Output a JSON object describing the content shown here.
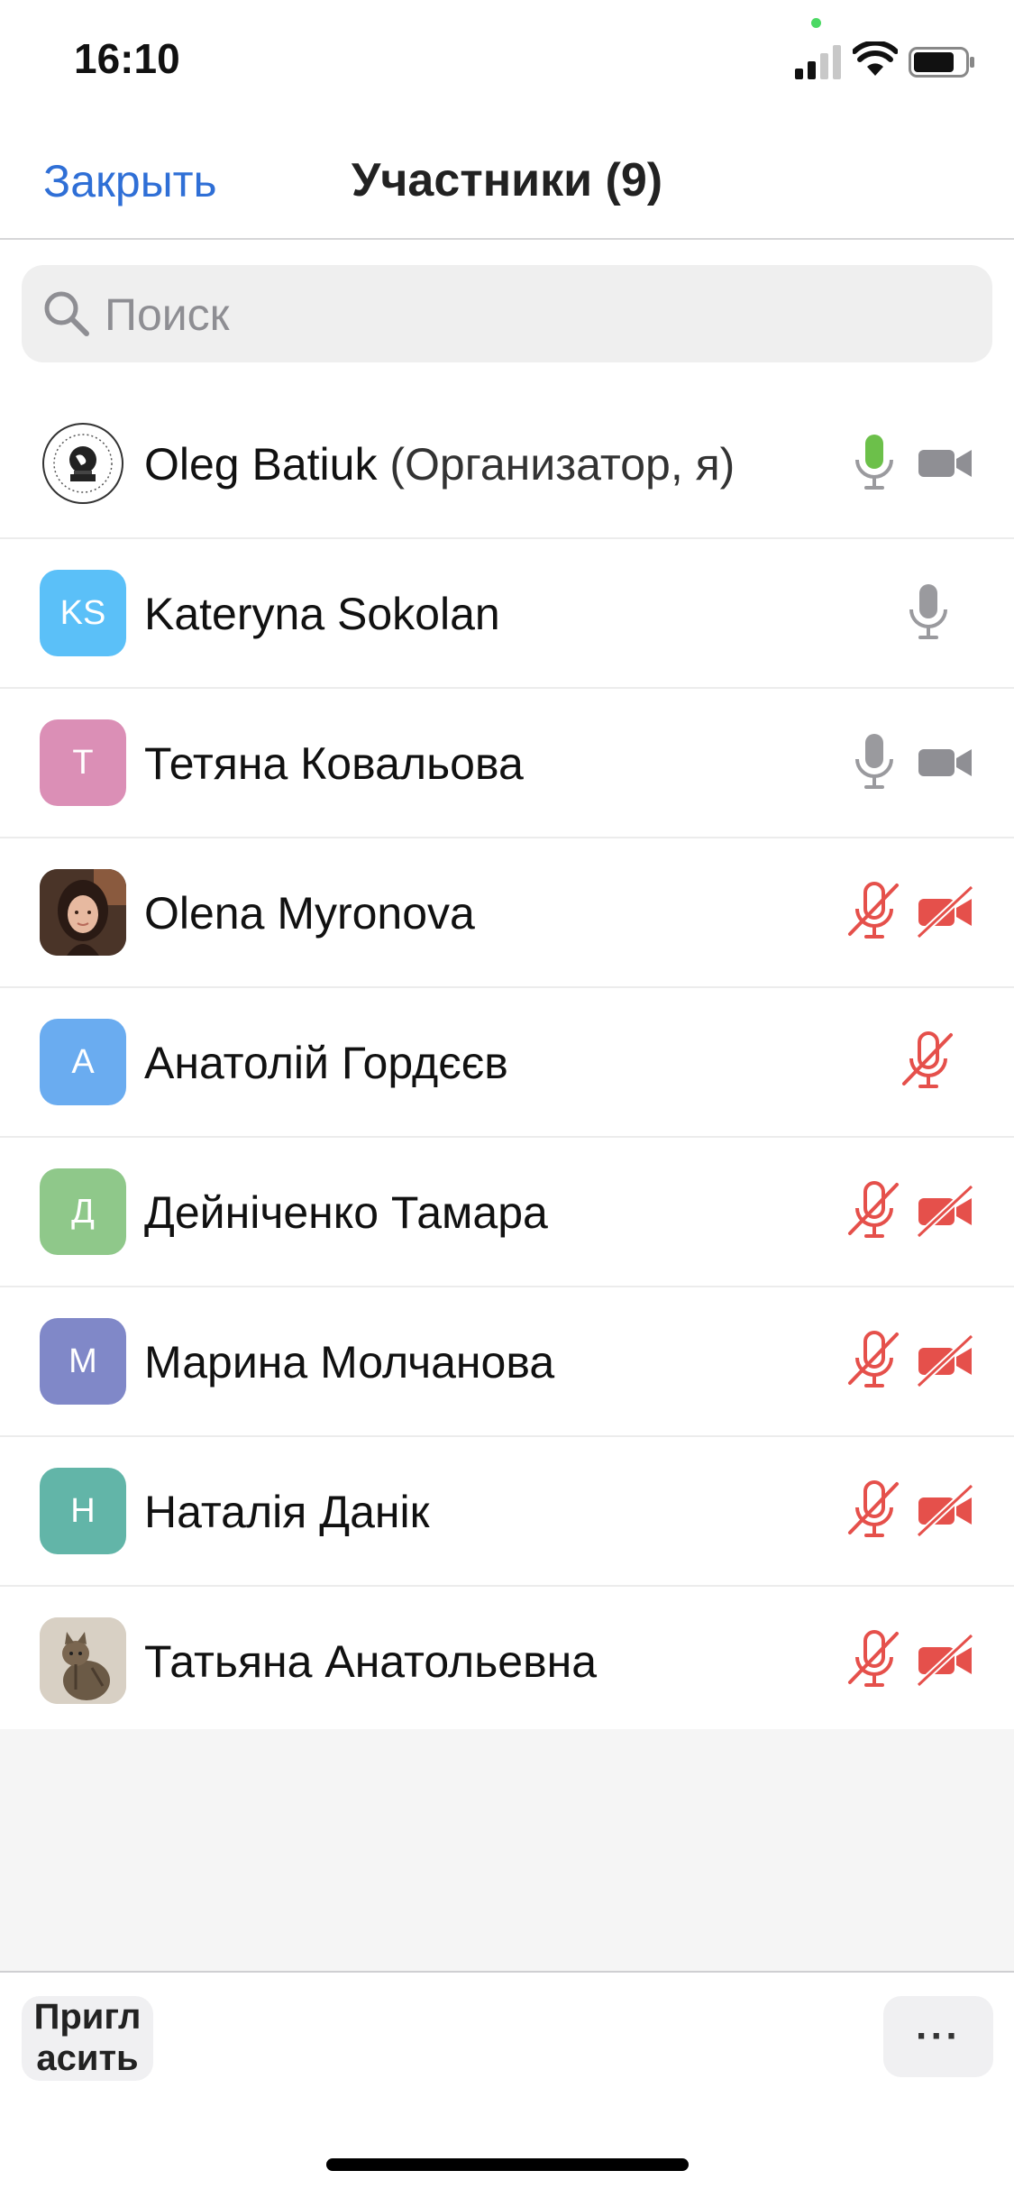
{
  "status_bar": {
    "time": "16:10",
    "icons": [
      "signal-icon",
      "wifi-icon",
      "battery-icon"
    ]
  },
  "header": {
    "close_label": "Закрыть",
    "title": "Участники (9)"
  },
  "search": {
    "placeholder": "Поиск",
    "value": ""
  },
  "participants": [
    {
      "name": "Oleg Batiuk",
      "role": "(Организатор, я)",
      "avatar_type": "logo",
      "mic": "on-active",
      "camera": "on"
    },
    {
      "name": "Kateryna Sokolan",
      "avatar_initials": "KS",
      "avatar_color": "#5bc0f8",
      "mic": "on",
      "camera": "none"
    },
    {
      "name": "Тетяна Ковальова",
      "avatar_initials": "T",
      "avatar_color": "#db8fb6",
      "mic": "on",
      "camera": "on"
    },
    {
      "name": "Olena Myronova",
      "avatar_type": "photo",
      "mic": "muted",
      "camera": "off"
    },
    {
      "name": "Анатолій Гордєєв",
      "avatar_initials": "А",
      "avatar_color": "#6aacf0",
      "mic": "muted",
      "camera": "none"
    },
    {
      "name": "Дейніченко Тамара",
      "avatar_initials": "Д",
      "avatar_color": "#8fc88a",
      "mic": "muted",
      "camera": "off"
    },
    {
      "name": "Марина Молчанова",
      "avatar_initials": "М",
      "avatar_color": "#8088c8",
      "mic": "muted",
      "camera": "off"
    },
    {
      "name": "Наталія Данік",
      "avatar_initials": "Н",
      "avatar_color": "#62b5a8",
      "mic": "muted",
      "camera": "off"
    },
    {
      "name": "Татьяна Анатольевна",
      "avatar_type": "cat-photo",
      "mic": "muted",
      "camera": "off"
    }
  ],
  "colors": {
    "accent": "#2f6fd6",
    "muted": "#e5504b",
    "active_mic": "#6cc04a",
    "icon_gray": "#9a9a9e"
  },
  "bottom_bar": {
    "invite_label": "Пригл\nасить",
    "more_label": "···"
  }
}
